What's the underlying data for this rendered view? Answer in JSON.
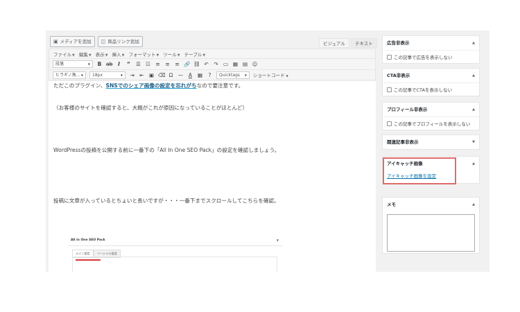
{
  "editor": {
    "media_buttons": [
      {
        "label": "メディアを追加",
        "icon": "media-icon"
      },
      {
        "label": "商品リンク追加",
        "icon": "product-link-icon"
      }
    ],
    "tabs": {
      "visual": "ビジュアル",
      "text": "テキスト"
    },
    "menus": [
      "ファイル",
      "編集",
      "表示",
      "挿入",
      "フォーマット",
      "ツール",
      "テーブル"
    ],
    "toolbar1": {
      "format_select": "段落",
      "quicktags": "Quicktags"
    },
    "toolbar2": {
      "font_select": "ヒラギノ角...",
      "size_select": "18px",
      "shortcode": "ショートコード"
    }
  },
  "content": {
    "p1_before": "ただこのプラグイン、",
    "p1_highlight": "SNSでのシェア画像の設定を忘れがち",
    "p1_after": "なので要注意です。",
    "p2": "（お客様のサイトを確認すると、大概がこれが原因になっていることがほとんど）",
    "p3": "WordPressの投稿を公開する前に一番下の「All In One SEO Pack」の設定を確認しましょう。",
    "p4": "投稿に文章が入っているとちょいと長いですが・・・一番下までスクロールしてこちらを確認。",
    "seo_screenshot": {
      "title": "All in One SEO Pack",
      "tabs": [
        "メイン設定",
        "ソーシャル設定"
      ]
    }
  },
  "sidebar": {
    "boxes": [
      {
        "title": "広告非表示",
        "checkbox": "この記事で広告を表示しない"
      },
      {
        "title": "CTA非表示",
        "checkbox": "この記事でCTAを表示しない"
      },
      {
        "title": "プロフィール非表示",
        "checkbox": "この記事でプロフィールを表示しない"
      },
      {
        "title": "関連記事非表示"
      },
      {
        "title": "アイキャッチ画像",
        "link": "アイキャッチ画像を設定"
      },
      {
        "title": "メモ"
      }
    ]
  },
  "colors": {
    "highlight_box": "#e06b6b",
    "link": "#0073aa",
    "emphasis": "#1d5f87"
  }
}
